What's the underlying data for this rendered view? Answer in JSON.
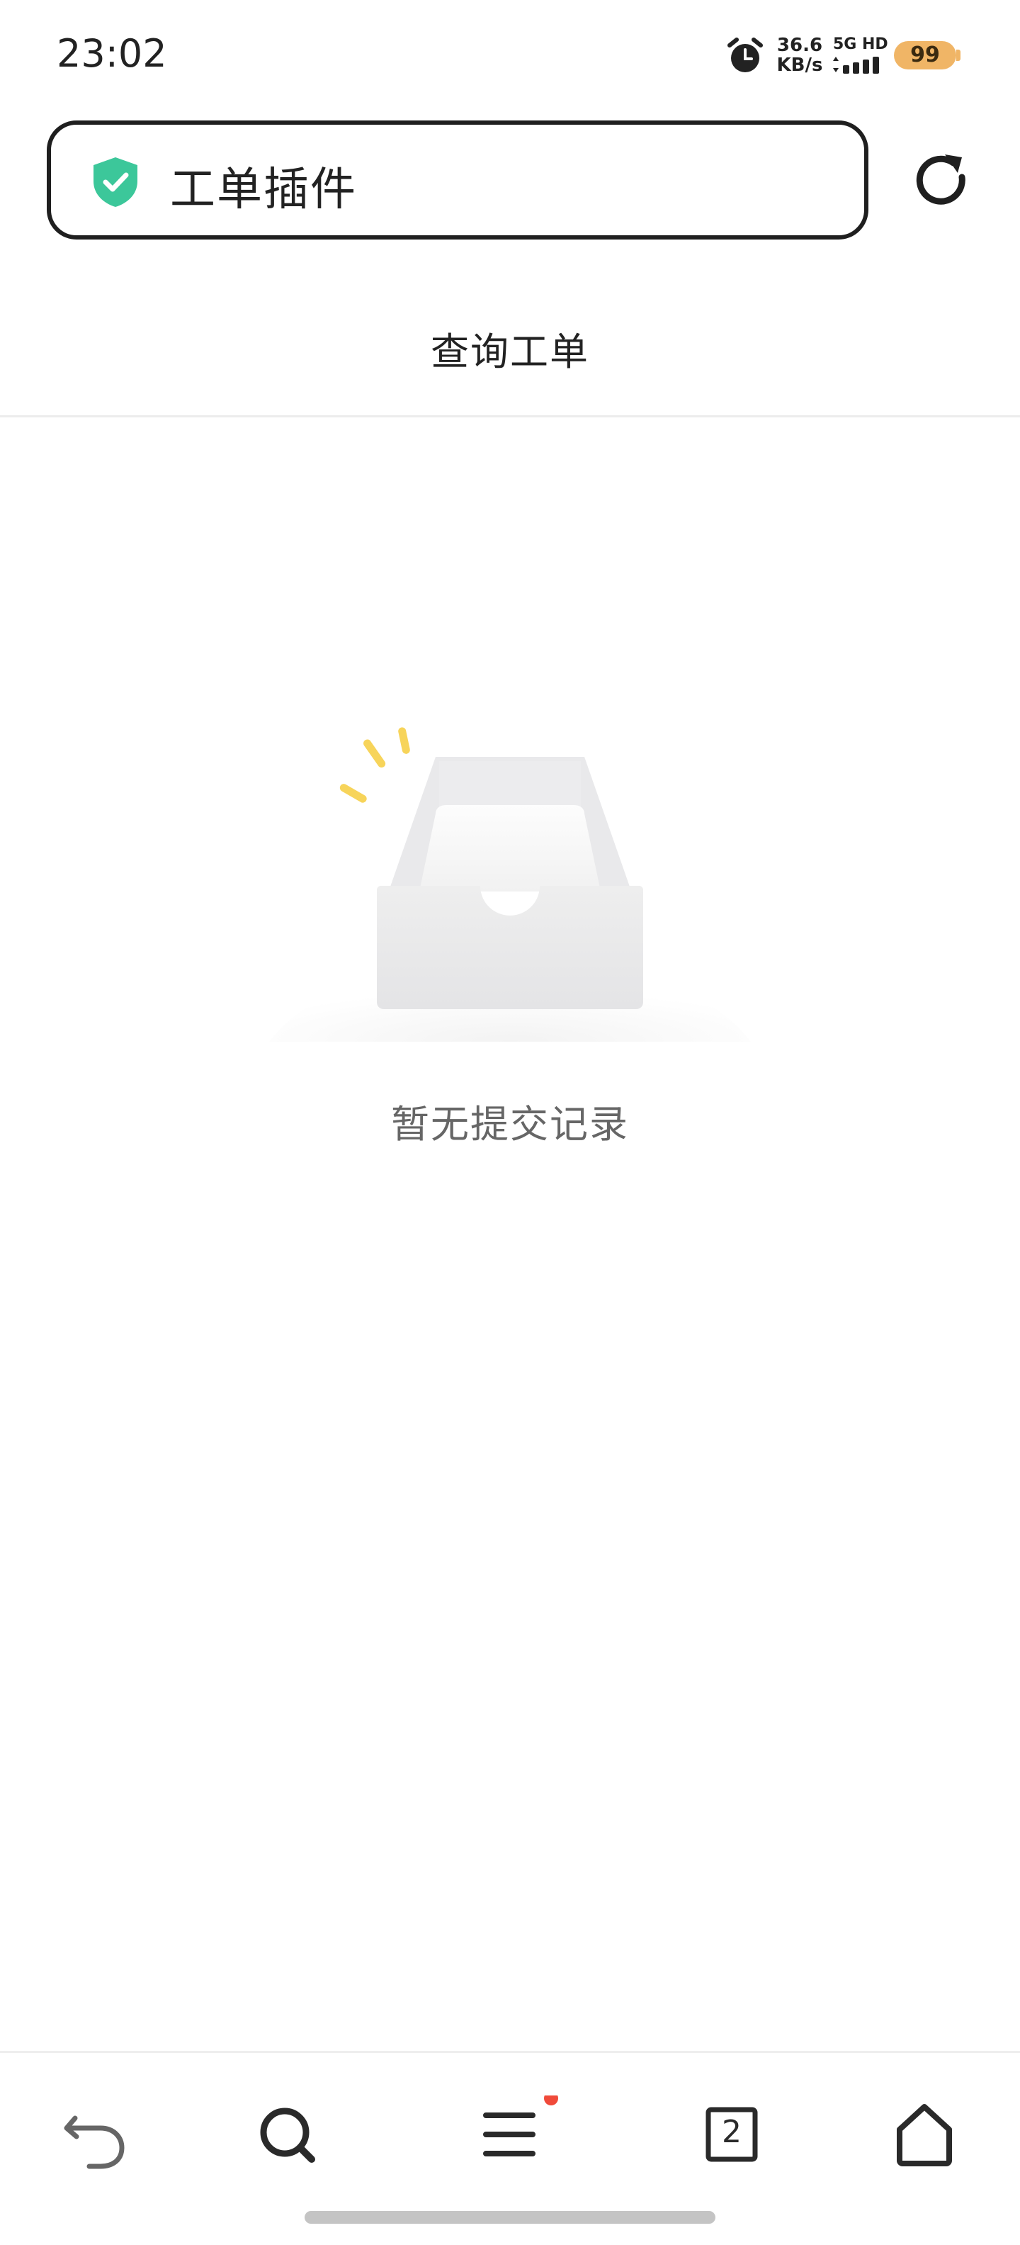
{
  "status_bar": {
    "time": "23:02",
    "net_speed_value": "36.6",
    "net_speed_unit": "KB/s",
    "network_type": "5G HD",
    "battery_level": "99",
    "icons": [
      "alarm-icon",
      "signal-icon",
      "battery-icon"
    ]
  },
  "address_bar": {
    "title": "工单插件",
    "secure_icon": "shield-check-icon",
    "action_icon": "refresh-icon"
  },
  "page": {
    "title": "查询工单"
  },
  "empty_state": {
    "illustration": "empty-tray-illustration",
    "message": "暂无提交记录"
  },
  "bottom_nav": {
    "items": [
      {
        "icon": "back-icon"
      },
      {
        "icon": "search-icon"
      },
      {
        "icon": "menu-icon",
        "badge_color": "#f04a3a"
      },
      {
        "icon": "tabs-icon",
        "count": "2"
      },
      {
        "icon": "home-icon"
      }
    ]
  },
  "colors": {
    "shield": "#3cc79a",
    "battery": "#f0b566",
    "badge": "#f04a3a",
    "sparkle": "#f7d45a"
  }
}
